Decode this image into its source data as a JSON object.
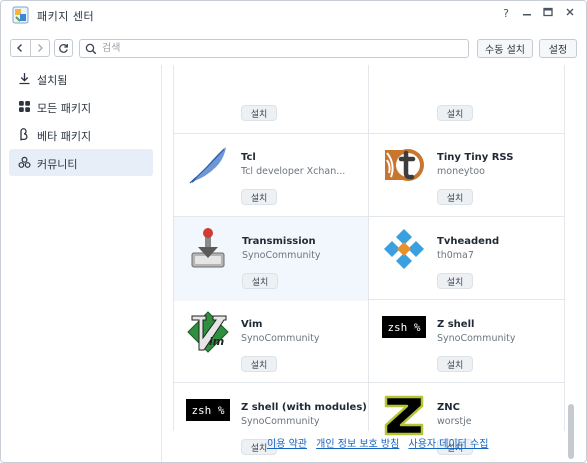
{
  "window": {
    "title": "패키지 센터"
  },
  "toolbar": {
    "search_placeholder": "검색",
    "manual_install_label": "수동 설치",
    "settings_label": "설정"
  },
  "sidebar": {
    "items": [
      {
        "label": "설치됨",
        "icon": "download-icon"
      },
      {
        "label": "모든 패키지",
        "icon": "grid-icon"
      },
      {
        "label": "베타 패키지",
        "icon": "beta-icon"
      },
      {
        "label": "커뮤니티",
        "icon": "community-icon",
        "active": true
      }
    ]
  },
  "packages": [
    {
      "name": "",
      "author": "",
      "install_label": "설치"
    },
    {
      "name": "",
      "author": "",
      "install_label": "설치"
    },
    {
      "name": "Tcl",
      "author": "Tcl developer Xchan...",
      "install_label": "설치",
      "icon": "tcl-feather-icon"
    },
    {
      "name": "Tiny Tiny RSS",
      "author": "moneytoo",
      "install_label": "설치",
      "icon": "ttrss-icon"
    },
    {
      "name": "Transmission",
      "author": "SynoCommunity",
      "install_label": "설치",
      "icon": "transmission-icon"
    },
    {
      "name": "Tvheadend",
      "author": "th0ma7",
      "install_label": "설치",
      "icon": "tvheadend-icon"
    },
    {
      "name": "Vim",
      "author": "SynoCommunity",
      "install_label": "설치",
      "icon": "vim-icon"
    },
    {
      "name": "Z shell",
      "author": "SynoCommunity",
      "install_label": "설치",
      "icon": "zsh-icon",
      "icon_text": "zsh %"
    },
    {
      "name": "Z shell (with modules)",
      "author": "SynoCommunity",
      "install_label": "설치",
      "icon": "zsh-icon",
      "icon_text": "zsh %"
    },
    {
      "name": "ZNC",
      "author": "worstje",
      "install_label": "설치",
      "icon": "znc-icon"
    }
  ],
  "footer": {
    "terms": "이용 약관",
    "privacy": "개인 정보 보호 방침",
    "data_collection": "사용자 데이터 수집"
  },
  "colors": {
    "link": "#1565c0",
    "active_bg": "#e8eef8"
  }
}
